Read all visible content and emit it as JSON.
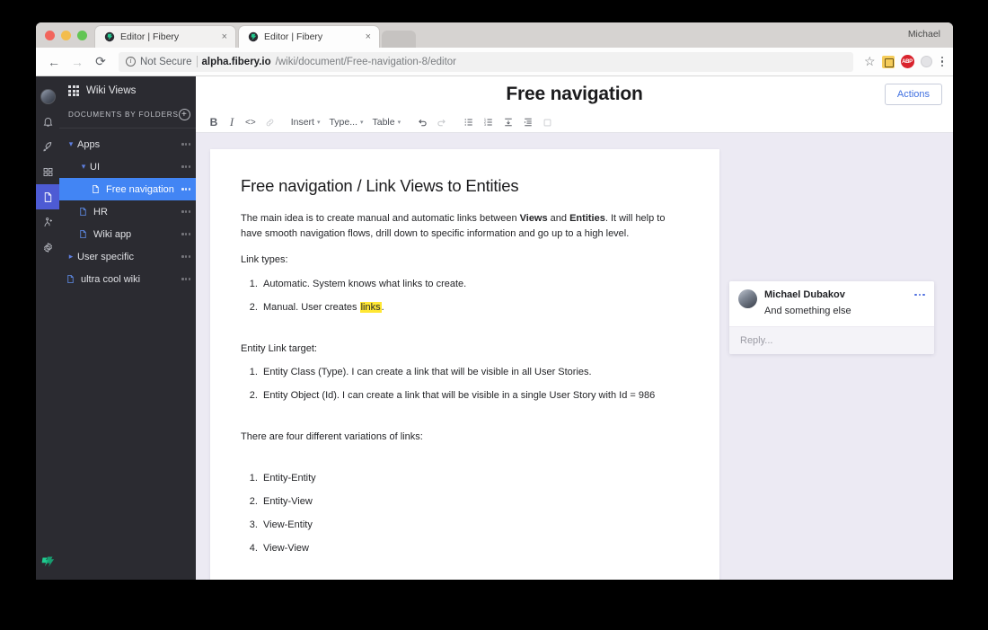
{
  "os": {
    "user_label": "Michael"
  },
  "browser": {
    "tabs": [
      {
        "title": "Editor | Fibery",
        "favicon": "fibery-favicon",
        "close": "×",
        "active": false
      },
      {
        "title": "Editor | Fibery",
        "favicon": "fibery-favicon",
        "close": "×",
        "active": true
      }
    ],
    "nav": {
      "back": "←",
      "forward": "→",
      "reload": "⟳"
    },
    "address": {
      "security_label": "Not Secure",
      "host": "alpha.fibery.io",
      "path": "/wiki/document/Free-navigation-8/editor",
      "full_url": "alpha.fibery.io/wiki/document/Free-navigation-8/editor"
    },
    "omni_icons": {
      "bookmark": "☆",
      "extension_1": "extension-icon",
      "extension_abp": "ABP",
      "extension_gray": "extension-gray-icon",
      "menu": "⋮"
    }
  },
  "rail": {
    "items": [
      {
        "name": "avatar",
        "label": "User avatar"
      },
      {
        "name": "notifications",
        "label": "Notifications"
      },
      {
        "name": "whats-new",
        "label": "What's new"
      },
      {
        "name": "apps-grid",
        "label": "Apps"
      },
      {
        "name": "documents",
        "label": "Documents",
        "active": true
      },
      {
        "name": "automations",
        "label": "Automations"
      },
      {
        "name": "settings",
        "label": "Settings"
      }
    ],
    "logo": "fibery-logo"
  },
  "sidebar": {
    "header": {
      "label": "Wiki Views",
      "icon": "grid-icon"
    },
    "section": {
      "label": "DOCUMENTS BY FOLDERS",
      "add_button": "+"
    },
    "tree": [
      {
        "label": "Apps",
        "indent": 0,
        "twisty": "down",
        "icon": "none",
        "selected": false,
        "menu": "..."
      },
      {
        "label": "UI",
        "indent": 1,
        "twisty": "down",
        "icon": "none",
        "selected": false,
        "menu": "..."
      },
      {
        "label": "Free navigation",
        "indent": 2,
        "twisty": "none",
        "icon": "document",
        "selected": true,
        "menu": "..."
      },
      {
        "label": "HR",
        "indent": 1,
        "twisty": "none",
        "icon": "document",
        "selected": false,
        "menu": "..."
      },
      {
        "label": "Wiki app",
        "indent": 1,
        "twisty": "none",
        "icon": "document",
        "selected": false,
        "menu": "..."
      },
      {
        "label": "User specific",
        "indent": 0,
        "twisty": "right",
        "icon": "none",
        "selected": false,
        "menu": "..."
      },
      {
        "label": "ultra cool wiki",
        "indent": 0,
        "twisty": "none",
        "icon": "document",
        "selected": false,
        "menu": "..."
      }
    ]
  },
  "document_header": {
    "title": "Free navigation",
    "actions_label": "Actions"
  },
  "toolbar": {
    "bold": "B",
    "italic": "I",
    "code": "<>",
    "link": "link-icon",
    "insert": "Insert",
    "type": "Type...",
    "table": "Table",
    "undo": "undo-icon",
    "redo": "redo-icon",
    "bullet_list": "bullet-list-icon",
    "numbered_list": "numbered-list-icon",
    "collapse": "collapse-icon",
    "indent": "indent-icon",
    "placeholder_block": "block-icon",
    "caret": "▾"
  },
  "document": {
    "heading": "Free navigation / Link Views to Entities",
    "intro_part1": "The main idea is to create manual and automatic links between ",
    "intro_bold1": "Views",
    "intro_mid": " and ",
    "intro_bold2": "Entities",
    "intro_part2": ". It will help to have smooth navigation flows, drill down to specific information and go up to a high level.",
    "link_types_label": "Link types:",
    "link_types": [
      {
        "text": "Automatic. System knows what links to create."
      },
      {
        "pre": "Manual. User creates ",
        "highlight": "links",
        "post": "."
      }
    ],
    "entity_target_label": "Entity Link target:",
    "entity_targets": [
      "Entity Class (Type). I can create a link that will be visible in all User Stories.",
      "Entity Object (Id). I can create a link that will be visible in a single User Story with Id = 986"
    ],
    "variations_label": "There are four different variations of links:",
    "variations": [
      "Entity-Entity",
      "Entity-View",
      "View-Entity",
      "View-View"
    ]
  },
  "comment": {
    "author": "Michael Dubakov",
    "text": "And something else",
    "menu": "...",
    "reply_placeholder": "Reply..."
  }
}
